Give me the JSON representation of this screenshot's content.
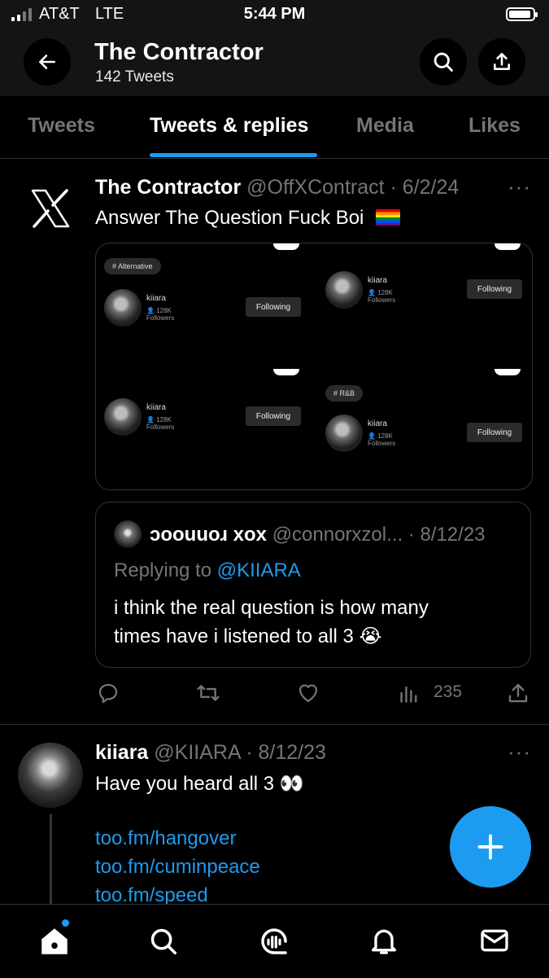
{
  "status_bar": {
    "carrier": "AT&T",
    "network": "LTE",
    "time": "5:44 PM"
  },
  "header": {
    "title": "The Contractor",
    "subtitle": "142 Tweets"
  },
  "tabs": [
    {
      "label": "Tweets"
    },
    {
      "label": "Tweets & replies",
      "active": true
    },
    {
      "label": "Media"
    },
    {
      "label": "Likes"
    }
  ],
  "tweet1": {
    "author_name": "The Contractor",
    "handle_date": "@OffXContract · 6/2/24",
    "text": "Answer The Question Fuck Boi",
    "emoji": "🏳️‍🌈",
    "media": {
      "tag_alternative": "# Alternative",
      "tag_rnb": "# R&B",
      "artist_name": "kiiara",
      "followers": "128K Followers",
      "follow_label": "Following"
    },
    "quote": {
      "author_name": "ɔoouuoɹ xox",
      "handle_date": "@connorxzol... · 8/12/23",
      "replying_prefix": "Replying to",
      "replying_handle": "@KIIARA",
      "text_line1": "i think the real question is how many",
      "text_line2": "times have i listened to all 3 😭"
    },
    "views": "235"
  },
  "tweet2": {
    "author_name": "kiiara",
    "handle_date": "@KIIARA · 8/12/23",
    "text": "Have you heard all 3 👀",
    "links": [
      "too.fm/hangover",
      "too.fm/cuminpeace",
      "too.fm/speed"
    ]
  },
  "colors": {
    "accent": "#1d9bf0",
    "background": "#000000",
    "muted": "#71767b"
  }
}
